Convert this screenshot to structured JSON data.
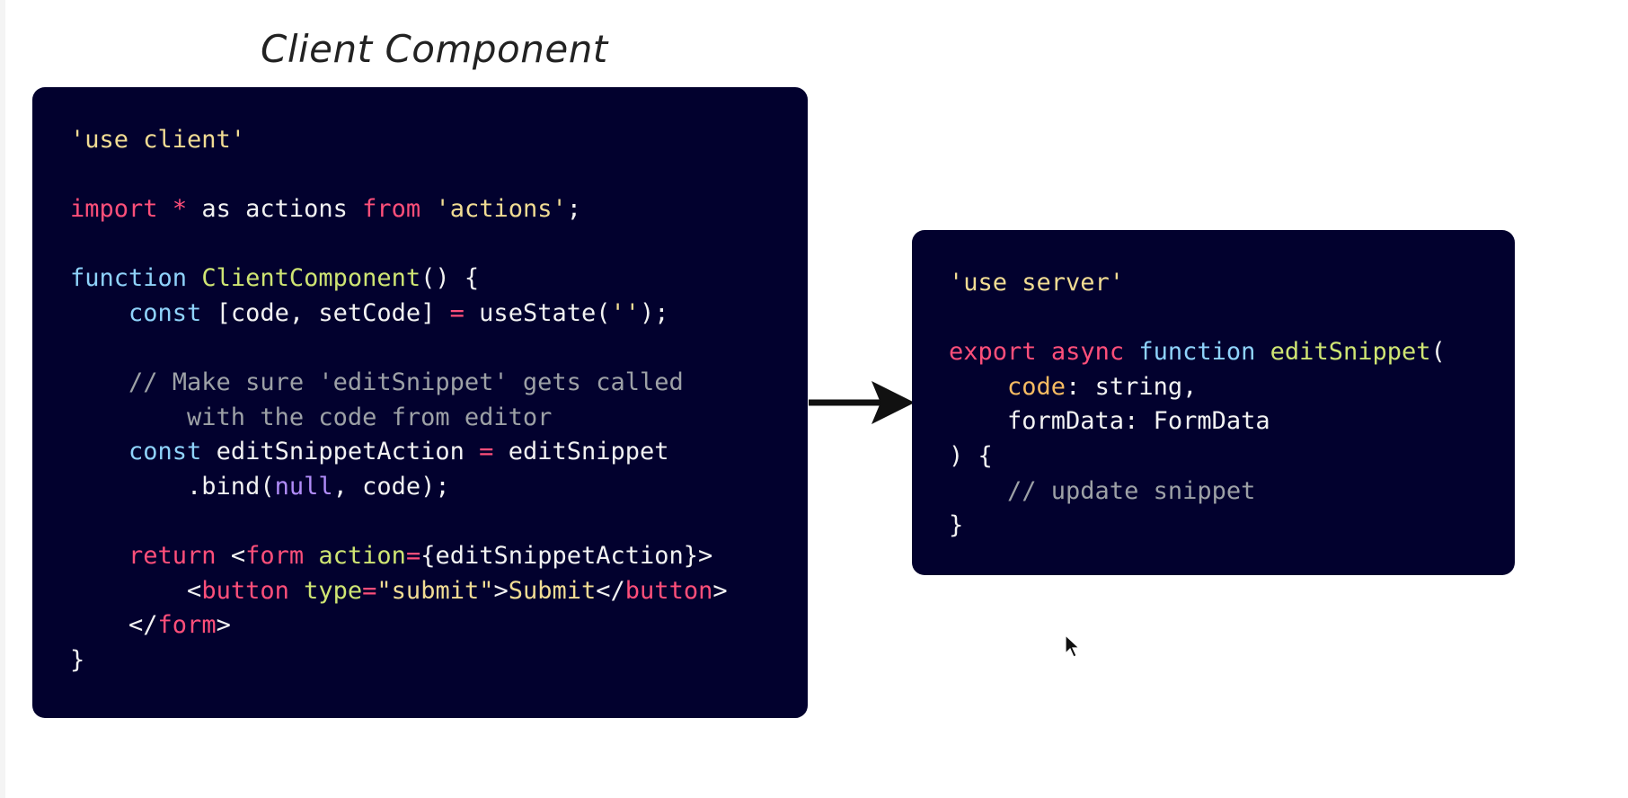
{
  "title": "Client Component",
  "client_code": [
    [
      {
        "t": "'use client'",
        "c": "str"
      }
    ],
    [],
    [
      {
        "t": "import",
        "c": "kw"
      },
      {
        "t": " ",
        "c": "plain"
      },
      {
        "t": "*",
        "c": "kw"
      },
      {
        "t": " as actions ",
        "c": "plain"
      },
      {
        "t": "from",
        "c": "kw"
      },
      {
        "t": " ",
        "c": "plain"
      },
      {
        "t": "'actions'",
        "c": "str"
      },
      {
        "t": ";",
        "c": "plain"
      }
    ],
    [],
    [
      {
        "t": "function",
        "c": "decl"
      },
      {
        "t": " ",
        "c": "plain"
      },
      {
        "t": "ClientComponent",
        "c": "fn"
      },
      {
        "t": "() {",
        "c": "plain"
      }
    ],
    [
      {
        "t": "    ",
        "c": "plain"
      },
      {
        "t": "const",
        "c": "decl"
      },
      {
        "t": " [code, setCode] ",
        "c": "plain"
      },
      {
        "t": "=",
        "c": "kw"
      },
      {
        "t": " useState(",
        "c": "plain"
      },
      {
        "t": "''",
        "c": "str"
      },
      {
        "t": ");",
        "c": "plain"
      }
    ],
    [],
    [
      {
        "t": "    // Make sure 'editSnippet' gets called",
        "c": "com"
      }
    ],
    [
      {
        "t": "        with the code from editor",
        "c": "com"
      }
    ],
    [
      {
        "t": "    ",
        "c": "plain"
      },
      {
        "t": "const",
        "c": "decl"
      },
      {
        "t": " editSnippetAction ",
        "c": "plain"
      },
      {
        "t": "=",
        "c": "kw"
      },
      {
        "t": " editSnippet",
        "c": "plain"
      }
    ],
    [
      {
        "t": "        .bind(",
        "c": "plain"
      },
      {
        "t": "null",
        "c": "num"
      },
      {
        "t": ", code);",
        "c": "plain"
      }
    ],
    [],
    [
      {
        "t": "    ",
        "c": "plain"
      },
      {
        "t": "return",
        "c": "kw"
      },
      {
        "t": " <",
        "c": "plain"
      },
      {
        "t": "form",
        "c": "kw"
      },
      {
        "t": " ",
        "c": "plain"
      },
      {
        "t": "action",
        "c": "fn"
      },
      {
        "t": "=",
        "c": "kw"
      },
      {
        "t": "{editSnippetAction}>",
        "c": "plain"
      }
    ],
    [
      {
        "t": "        <",
        "c": "plain"
      },
      {
        "t": "button",
        "c": "kw"
      },
      {
        "t": " ",
        "c": "plain"
      },
      {
        "t": "type",
        "c": "fn"
      },
      {
        "t": "=",
        "c": "kw"
      },
      {
        "t": "\"submit\"",
        "c": "str"
      },
      {
        "t": ">",
        "c": "plain"
      },
      {
        "t": "Submit",
        "c": "str"
      },
      {
        "t": "</",
        "c": "plain"
      },
      {
        "t": "button",
        "c": "kw"
      },
      {
        "t": ">",
        "c": "plain"
      }
    ],
    [
      {
        "t": "    </",
        "c": "plain"
      },
      {
        "t": "form",
        "c": "kw"
      },
      {
        "t": ">",
        "c": "plain"
      }
    ],
    [
      {
        "t": "}",
        "c": "plain"
      }
    ]
  ],
  "server_code": [
    [
      {
        "t": "'use server'",
        "c": "str"
      }
    ],
    [],
    [
      {
        "t": "export",
        "c": "kw"
      },
      {
        "t": " ",
        "c": "plain"
      },
      {
        "t": "async",
        "c": "kw"
      },
      {
        "t": " ",
        "c": "plain"
      },
      {
        "t": "function",
        "c": "decl"
      },
      {
        "t": " ",
        "c": "plain"
      },
      {
        "t": "editSnippet",
        "c": "fn"
      },
      {
        "t": "(",
        "c": "plain"
      }
    ],
    [
      {
        "t": "    ",
        "c": "plain"
      },
      {
        "t": "code",
        "c": "param"
      },
      {
        "t": ": string,",
        "c": "plain"
      }
    ],
    [
      {
        "t": "    formData: FormData",
        "c": "plain"
      }
    ],
    [
      {
        "t": ") {",
        "c": "plain"
      }
    ],
    [
      {
        "t": "    // update snippet",
        "c": "com"
      }
    ],
    [
      {
        "t": "}",
        "c": "plain"
      }
    ]
  ],
  "colors": {
    "panel_bg": "#02012e",
    "string": "#f1dc93",
    "keyword": "#ff4f7a",
    "declaration": "#8fd3fb",
    "function": "#cfe573",
    "literal": "#b08cf8",
    "comment": "#9da1a6",
    "parameter": "#f6bb62"
  },
  "icons": {
    "arrow": "arrow-right-icon",
    "cursor": "mouse-pointer-icon"
  }
}
